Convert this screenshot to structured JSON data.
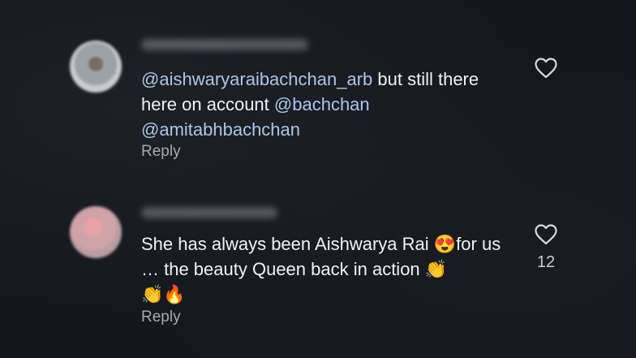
{
  "comments": [
    {
      "username": "",
      "mention1": "@aishwaryaraibachchan_arb",
      "text1": " but still there here on account ",
      "mention2": "@bachchan",
      "mention3": "@amitabhbachchan",
      "reply_label": "Reply"
    },
    {
      "username": "",
      "text_a": "She has always been Aishwarya Rai ",
      "emoji_a": "😍",
      "text_b": "for us … the beauty Queen back in action ",
      "emoji_b": "👏",
      "emoji_c": "👏",
      "emoji_d": "🔥",
      "like_count": "12",
      "reply_label": "Reply"
    }
  ],
  "icons": {
    "like": "heart-outline-icon"
  },
  "colors": {
    "background": "#14171c",
    "mention": "#a9c7ea",
    "text": "#f1f2f4",
    "secondary": "#a6aab0"
  }
}
